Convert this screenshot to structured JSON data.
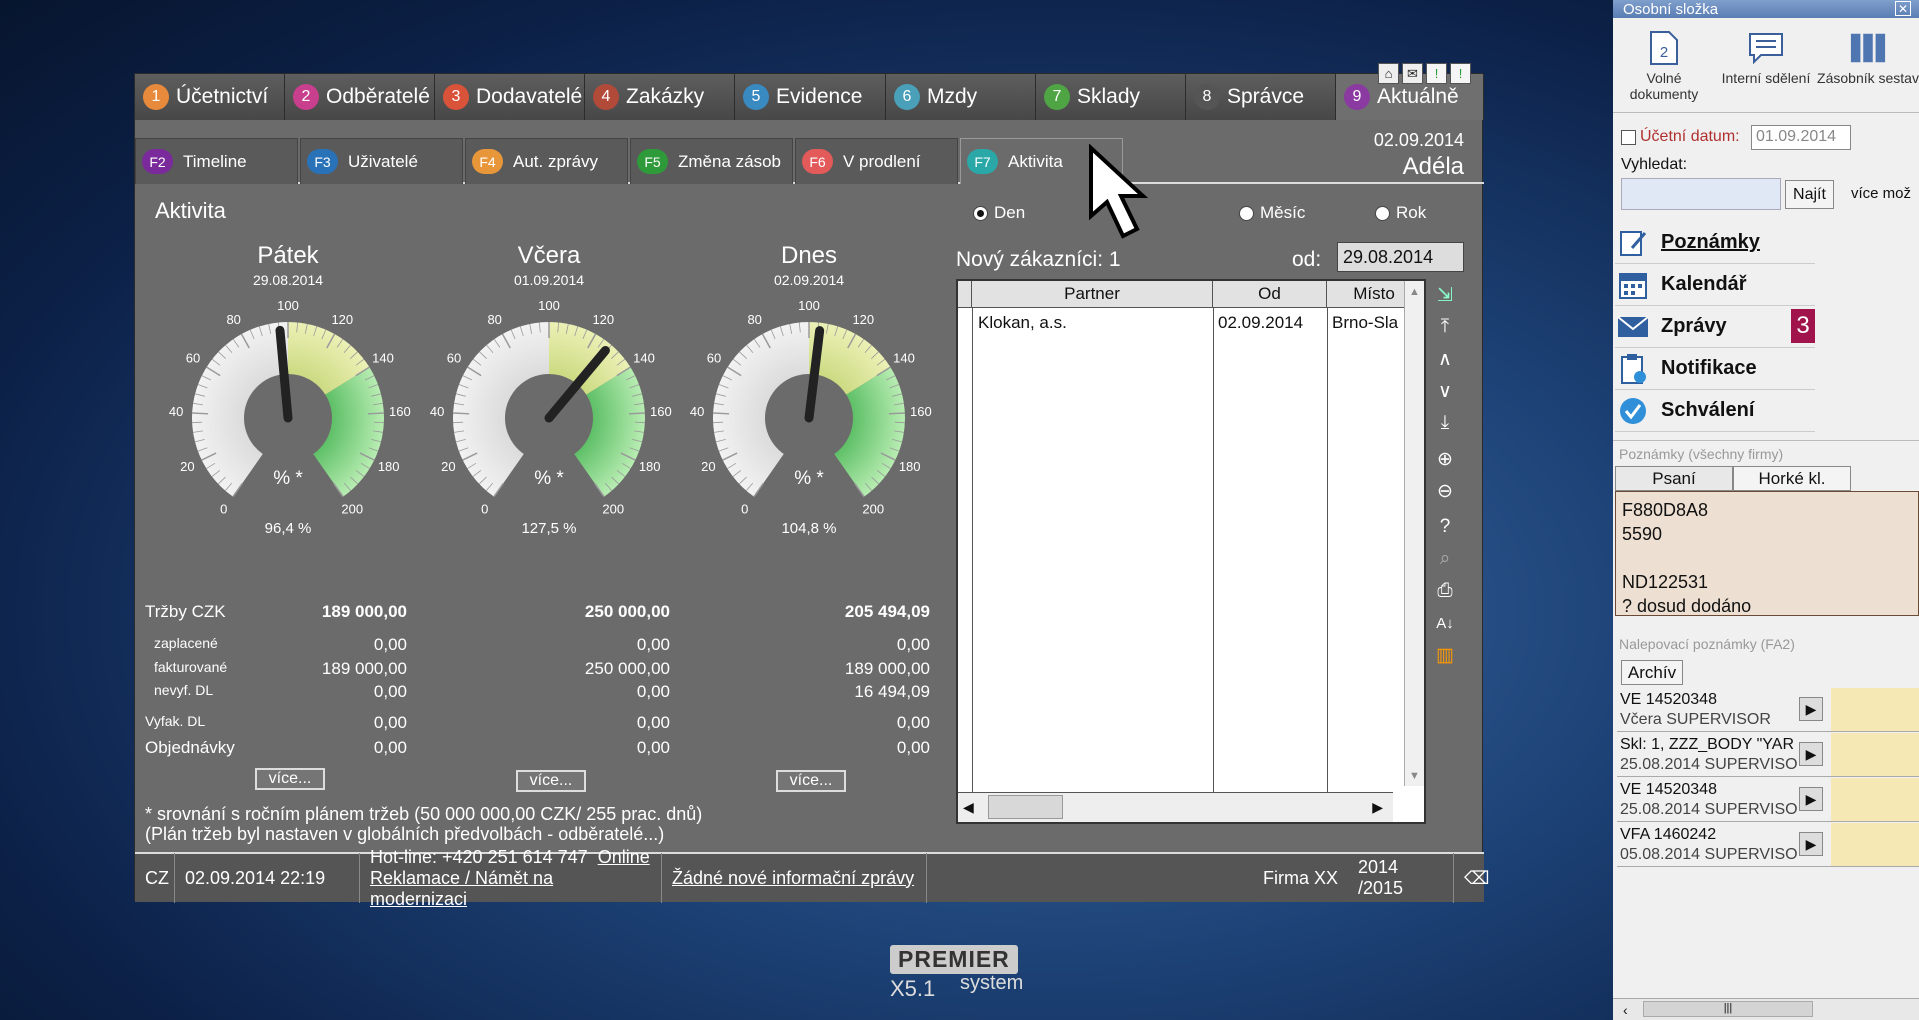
{
  "top_tabs": [
    {
      "num": "1",
      "label": "Účetnictví",
      "color": "#e88a3c"
    },
    {
      "num": "2",
      "label": "Odběratelé",
      "color": "#c83f8d"
    },
    {
      "num": "3",
      "label": "Dodavatelé",
      "color": "#d9523a"
    },
    {
      "num": "4",
      "label": "Zakázky",
      "color": "#b24a3a"
    },
    {
      "num": "5",
      "label": "Evidence",
      "color": "#3a8ac2"
    },
    {
      "num": "6",
      "label": "Mzdy",
      "color": "#4aa0b8"
    },
    {
      "num": "7",
      "label": "Sklady",
      "color": "#4fa544"
    },
    {
      "num": "8",
      "label": "Správce",
      "color": "#555555"
    },
    {
      "num": "9",
      "label": "Aktuálně",
      "color": "#8a3aa0"
    }
  ],
  "window_icons": [
    "⌂",
    "✉",
    "!",
    "!"
  ],
  "sub_tabs": [
    {
      "key": "F2",
      "label": "Timeline",
      "color": "#7a2a9a"
    },
    {
      "key": "F3",
      "label": "Uživatelé",
      "color": "#2a72b8"
    },
    {
      "key": "F4",
      "label": "Aut. zprávy",
      "color": "#e8963a"
    },
    {
      "key": "F5",
      "label": "Změna zásob",
      "color": "#2f9a3a"
    },
    {
      "key": "F6",
      "label": "V prodlení",
      "color": "#e25a5a"
    },
    {
      "key": "F7",
      "label": "Aktivita",
      "color": "#2aa8a8"
    }
  ],
  "header": {
    "date": "02.09.2014",
    "user": "Adéla"
  },
  "activity": {
    "title": "Aktivita",
    "periods": [
      "Den",
      "Měsíc",
      "Rok"
    ],
    "selected_period": "Den",
    "gauges": [
      {
        "title": "Pátek",
        "date": "29.08.2014",
        "percent_label": "96,4 %",
        "value": 96.4
      },
      {
        "title": "Včera",
        "date": "01.09.2014",
        "percent_label": "127,5 %",
        "value": 127.5
      },
      {
        "title": "Dnes",
        "date": "02.09.2014",
        "percent_label": "104,8 %",
        "value": 104.8
      }
    ],
    "gauge_ticks": [
      "0",
      "20",
      "40",
      "60",
      "80",
      "100",
      "120",
      "140",
      "160",
      "180",
      "200"
    ],
    "gauge_unit": "% *",
    "fin_labels": {
      "trzby": "Tržby CZK",
      "zaplacene": "zaplacené",
      "fakturovane": "fakturované",
      "nevyf": "nevyf. DL",
      "vyfak": "Vyfak. DL",
      "objednavky": "Objednávky"
    },
    "fin_values": [
      {
        "trzby": "189 000,00",
        "zaplacene": "0,00",
        "fakturovane": "189 000,00",
        "nevyf": "0,00",
        "vyfak": "0,00",
        "objednavky": "0,00"
      },
      {
        "trzby": "250 000,00",
        "zaplacene": "0,00",
        "fakturovane": "250 000,00",
        "nevyf": "0,00",
        "vyfak": "0,00",
        "objednavky": "0,00"
      },
      {
        "trzby": "205 494,09",
        "zaplacene": "0,00",
        "fakturovane": "189 000,00",
        "nevyf": "16 494,09",
        "vyfak": "0,00",
        "objednavky": "0,00"
      }
    ],
    "more_label": "více...",
    "note1": "* srovnání s ročním plánem tržeb (50 000 000,00 CZK/ 255 prac. dnů)",
    "note2": "(Plán tržeb byl nastaven v globálních předvolbách - odběratelé...)"
  },
  "customers": {
    "title": "Nový zákazníci: 1",
    "od_label": "od:",
    "od_value": "29.08.2014",
    "columns": [
      "Partner",
      "Od",
      "Místo"
    ],
    "rows": [
      {
        "partner": "Klokan, a.s.",
        "od": "02.09.2014",
        "misto": "Brno-Sla"
      }
    ]
  },
  "status": {
    "lang": "CZ",
    "datetime": "02.09.2014  22:19",
    "hotline": "Hot-line: +420 251 614 747",
    "online": "Online",
    "reklamace": "Reklamace / Námět na modernizaci",
    "info": "Žádné nové informační zprávy",
    "firma": "Firma XX",
    "period": "2014 /2015"
  },
  "logo": {
    "brand": "PREMIER",
    "version": "X5.1",
    "sub": "system"
  },
  "panel": {
    "title": "Osobní složka",
    "tools": [
      {
        "label": "Volné dokumenty",
        "badge": "2"
      },
      {
        "label": "Interní sdělení"
      },
      {
        "label": "Zásobník sestav"
      }
    ],
    "ucetni_label": "Účetní datum:",
    "ucetni_value": "01.09.2014",
    "vyhledat": "Vyhledat:",
    "najit": "Najít",
    "vice_moz": "více mož",
    "menu": [
      {
        "label": "Poznámky",
        "icon": "note-icon"
      },
      {
        "label": "Kalendář",
        "icon": "calendar-icon"
      },
      {
        "label": "Zprávy",
        "icon": "mail-icon",
        "badge": "3"
      },
      {
        "label": "Notifikace",
        "icon": "clipboard-icon"
      },
      {
        "label": "Schválení",
        "icon": "check-icon"
      }
    ],
    "notes_header": "Poznámky    (všechny firmy)",
    "note_tabs": [
      "Psaní",
      "Horké kl."
    ],
    "note_lines": [
      "F880D8A8",
      "5590",
      "",
      "ND122531",
      "? dosud dodáno"
    ],
    "sticky_header": "Nalepovací poznámky  (FA2)",
    "archiv": "Archív",
    "sticky": [
      {
        "line1": "VE 14520348",
        "line2": "Včera SUPERVISOR"
      },
      {
        "line1": "Skl: 1, ZZZ_BODY \"YAR",
        "line2": "25.08.2014 SUPERVISO"
      },
      {
        "line1": "VE 14520348",
        "line2": "25.08.2014 SUPERVISO"
      },
      {
        "line1": "VFA 1460242",
        "line2": "05.08.2014 SUPERVISO"
      }
    ]
  }
}
